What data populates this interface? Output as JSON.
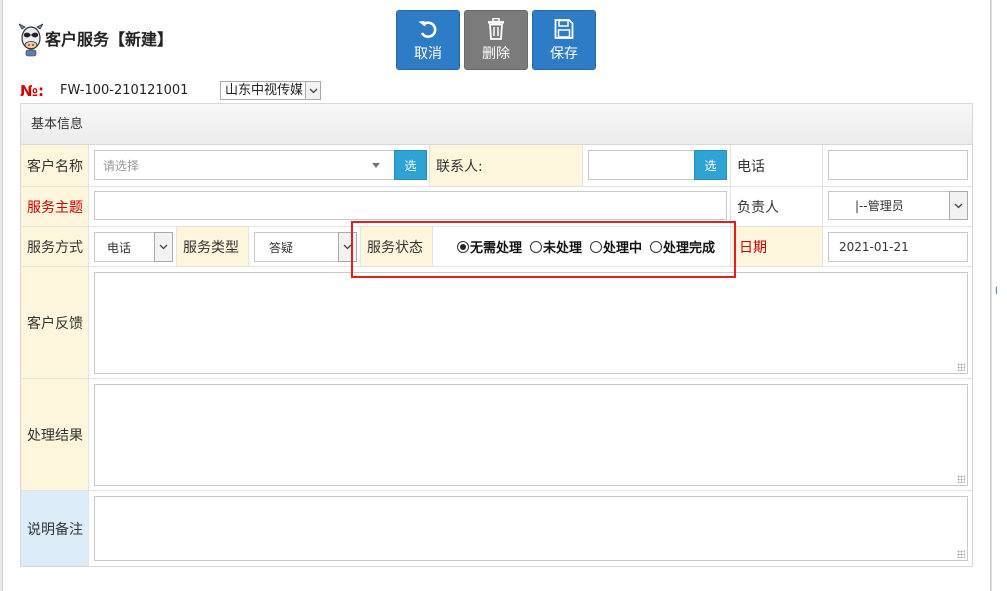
{
  "window": {
    "title": "客户服务【新建】",
    "logo_icon": "cow-mascot-icon"
  },
  "toolbar": {
    "cancel_label": "取消",
    "delete_label": "删除",
    "save_label": "保存",
    "cancel_icon": "undo-icon",
    "delete_icon": "trash-icon",
    "save_icon": "floppy-icon"
  },
  "record": {
    "no_label": "№:",
    "no_value": "FW-100-210121001",
    "org_value": "山东中视传媒"
  },
  "panel": {
    "heading": "基本信息"
  },
  "form": {
    "customer_label": "客户名称",
    "customer_placeholder": "请选择",
    "pick_label": "选",
    "contact_label": "联系人:",
    "contact_value": "",
    "phone_label": "电话",
    "phone_value": "",
    "subject_label": "服务主题",
    "subject_value": "",
    "owner_label": "负责人",
    "owner_value": "|--管理员",
    "method_label": "服务方式",
    "method_value": "电话",
    "type_label": "服务类型",
    "type_value": "答疑",
    "status_label": "服务状态",
    "status_options": [
      "无需处理",
      "未处理",
      "处理中",
      "处理完成"
    ],
    "status_selected": "无需处理",
    "date_label": "日期",
    "date_value": "2021-01-21",
    "feedback_label": "客户反馈",
    "result_label": "处理结果",
    "remark_label": "说明备注"
  },
  "colors": {
    "primary_button": "#2f7cc6",
    "delete_button": "#7b7b7b",
    "required_label": "#d40000",
    "label_bg": "#fdf5dc",
    "remark_label_bg": "#dcecf8",
    "pick_button": "#2fa3d3",
    "highlight_box": "#e02020"
  }
}
